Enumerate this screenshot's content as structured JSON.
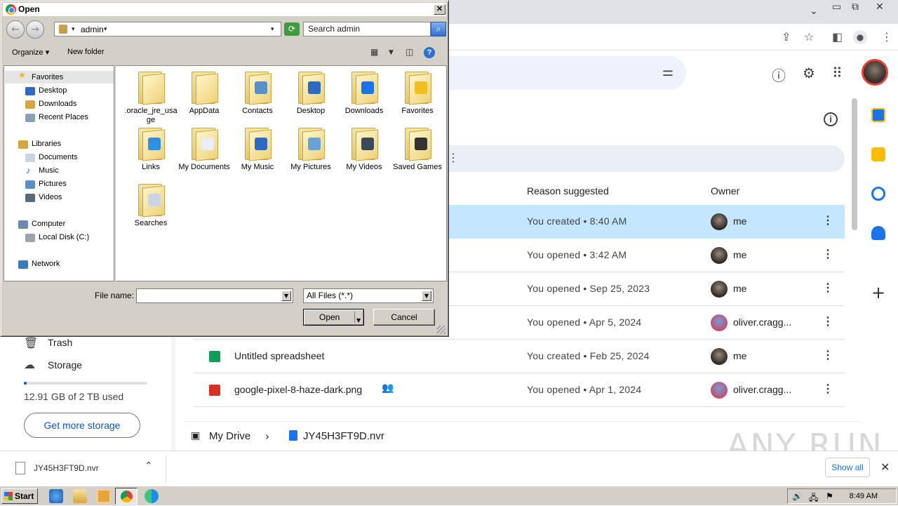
{
  "dialog": {
    "title": "Open",
    "close_label": "✕",
    "path": "admin",
    "search_placeholder": "Search admin",
    "toolbar": {
      "organize": "Organize ▾",
      "new_folder": "New folder"
    },
    "nav": {
      "favorites": "Favorites",
      "desktop": "Desktop",
      "downloads": "Downloads",
      "recent": "Recent Places",
      "libraries": "Libraries",
      "documents": "Documents",
      "music": "Music",
      "pictures": "Pictures",
      "videos": "Videos",
      "computer": "Computer",
      "local_disk": "Local Disk (C:)",
      "network": "Network"
    },
    "items": [
      {
        "label": ".oracle_jre_usage",
        "icon": "folder-plain-icon"
      },
      {
        "label": "AppData",
        "icon": "folder-plain-icon"
      },
      {
        "label": "Contacts",
        "icon": "contacts-folder-icon"
      },
      {
        "label": "Desktop",
        "icon": "desktop-folder-icon"
      },
      {
        "label": "Downloads",
        "icon": "downloads-folder-icon"
      },
      {
        "label": "Favorites",
        "icon": "favorites-folder-icon"
      },
      {
        "label": "Links",
        "icon": "links-folder-icon"
      },
      {
        "label": "My Documents",
        "icon": "documents-folder-icon"
      },
      {
        "label": "My Music",
        "icon": "music-folder-icon"
      },
      {
        "label": "My Pictures",
        "icon": "pictures-folder-icon"
      },
      {
        "label": "My Videos",
        "icon": "videos-folder-icon"
      },
      {
        "label": "Saved Games",
        "icon": "games-folder-icon"
      },
      {
        "label": "Searches",
        "icon": "searches-folder-icon"
      }
    ],
    "file_name_label": "File name:",
    "file_name_value": "",
    "filter": "All Files (*.*)",
    "open_label": "Open",
    "cancel_label": "Cancel"
  },
  "drive": {
    "columns": {
      "reason": "Reason suggested",
      "owner": "Owner"
    },
    "rows": [
      {
        "name": "",
        "reason": "You created • 8:40 AM",
        "owner": "me",
        "selected": true
      },
      {
        "name": "",
        "reason": "You opened • 3:42 AM",
        "owner": "me"
      },
      {
        "name": "",
        "reason": "You opened • Sep 25, 2023",
        "owner": "me"
      },
      {
        "name": "",
        "reason": "You opened • Apr 5, 2024",
        "owner": "oliver.cragg..."
      },
      {
        "name": "Untitled spreadsheet",
        "reason": "You created • Feb 25, 2024",
        "owner": "me"
      },
      {
        "name": "google-pixel-8-haze-dark.png",
        "reason": "You opened • Apr 1, 2024",
        "owner": "oliver.cragg..."
      }
    ],
    "nav": {
      "trash": "Trash",
      "storage": "Storage"
    },
    "storage_used_fraction": 0.0065,
    "storage_text": "12.91 GB of 2 TB used",
    "get_storage": "Get more storage",
    "breadcrumb": {
      "root": "My Drive",
      "file": "JY45H3FT9D.nvr"
    },
    "watermark": "ANY RUN"
  },
  "download_bar": {
    "file": "JY45H3FT9D.nvr",
    "show_all": "Show all"
  },
  "taskbar": {
    "start": "Start",
    "clock": "8:49 AM"
  },
  "colors": {
    "selected_row": "#c2e7ff",
    "accent": "#0b57d0"
  }
}
